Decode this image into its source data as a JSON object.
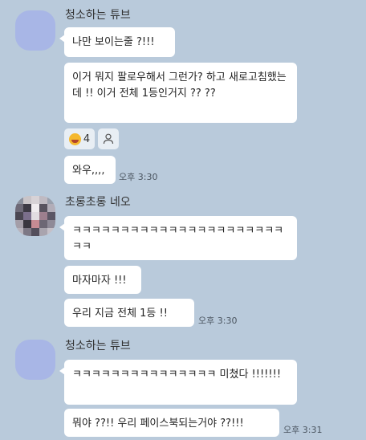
{
  "messages": [
    {
      "sender": "청소하는 튜브"
    },
    {
      "text": "나만 보이는줄 ?!!!"
    },
    {
      "text": "이거 뭐지 팔로우해서 그런가? 하고 새로고침했는데 !! 이거 전체 1등인거지 ?? ??"
    },
    {
      "reaction_count": "4"
    },
    {
      "text": "와우,,,,",
      "time": "오후 3:30"
    },
    {
      "sender": "초롱초롱 네오"
    },
    {
      "text": "ㅋㅋㅋㅋㅋㅋㅋㅋㅋㅋㅋㅋㅋㅋㅋㅋㅋㅋㅋㅋㅋㅋㅋㅋ"
    },
    {
      "text": "마자마자 !!!"
    },
    {
      "text": "우리 지금 전체 1등 !!",
      "time": "오후 3:30"
    },
    {
      "sender": "청소하는 튜브"
    },
    {
      "text": "ㅋㅋㅋㅋㅋㅋㅋㅋㅋㅋㅋㅋㅋㅋㅋ 미쳤다 !!!!!!!"
    },
    {
      "text": "뭐야 ??!! 우리 페이스북되는거야 ??!!!",
      "time": "오후 3:31"
    }
  ],
  "colors": {
    "background": "#b9cadb",
    "bubble": "#ffffff",
    "avatar_plain": "#a8b6e6"
  },
  "icons": {
    "reaction_emoji": "laughing-face-icon",
    "reaction_user": "person-icon"
  }
}
